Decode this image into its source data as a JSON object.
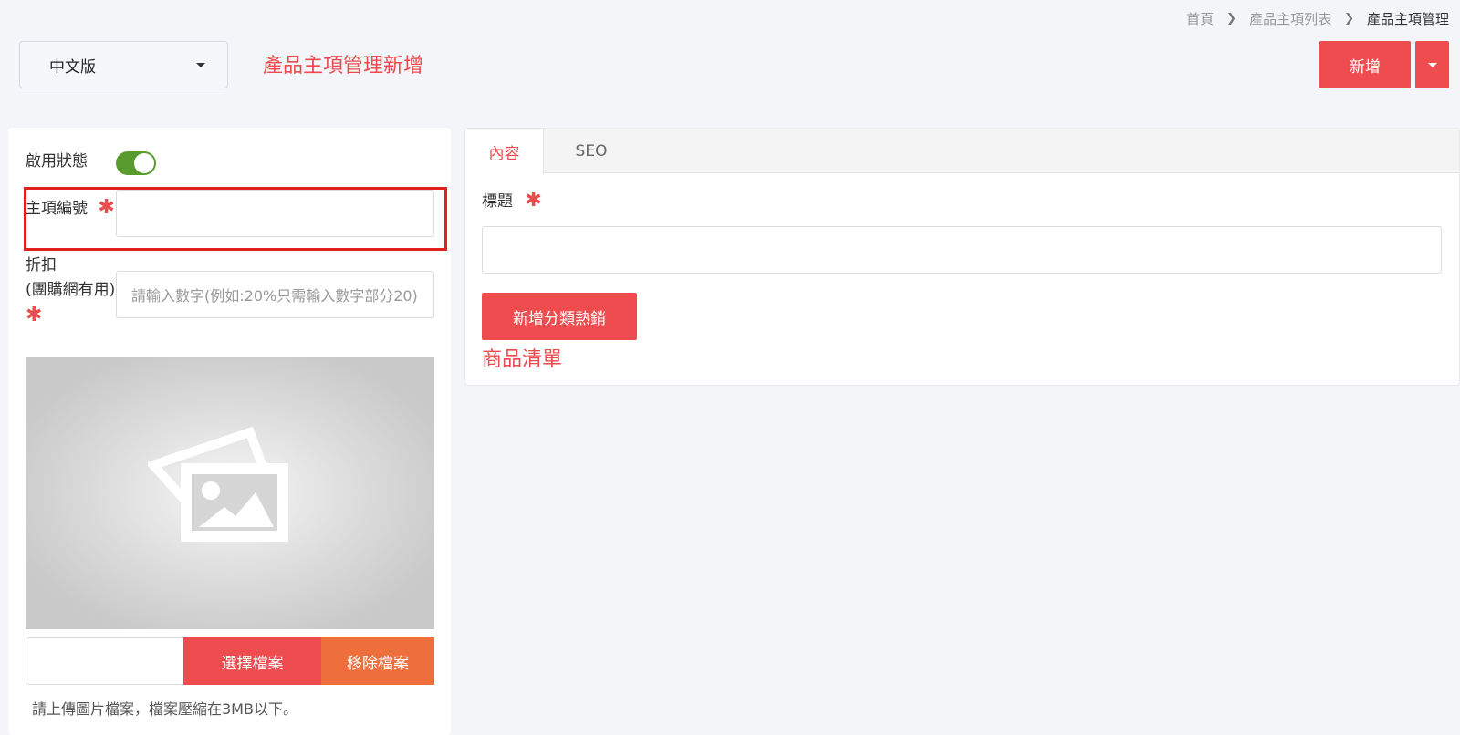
{
  "breadcrumb": {
    "home": "首頁",
    "list": "產品主項列表",
    "current": "產品主項管理"
  },
  "language": {
    "selected": "中文版"
  },
  "page_title": "產品主項管理新增",
  "actions": {
    "add_label": "新增"
  },
  "form": {
    "status_label": "啟用狀態",
    "status_on": true,
    "code_label": "主項編號",
    "code_value": "",
    "discount_label_line1": "折扣",
    "discount_label_line2": "(團購網有用)",
    "discount_placeholder": "請輸入數字(例如:20%只需輸入數字部分20)",
    "required_mark": "✱"
  },
  "upload": {
    "choose_label": "選擇檔案",
    "remove_label": "移除檔案",
    "help_text": "請上傳圖片檔案，檔案壓縮在3MB以下。"
  },
  "content": {
    "tabs": [
      {
        "label": "內容"
      },
      {
        "label": "SEO"
      }
    ],
    "title_label": "標題",
    "title_value": "",
    "hot_button_label": "新增分類熱銷",
    "product_list_label": "商品清單"
  },
  "colors": {
    "accent": "#ef4c4f",
    "orange": "#ee6f3c",
    "toggle_on": "#5a9b2e",
    "highlight": "#e0221f"
  },
  "icons": {
    "image_placeholder": "image-placeholder-icon",
    "chevron": "chevron-right-icon",
    "caret": "caret-down-icon"
  }
}
